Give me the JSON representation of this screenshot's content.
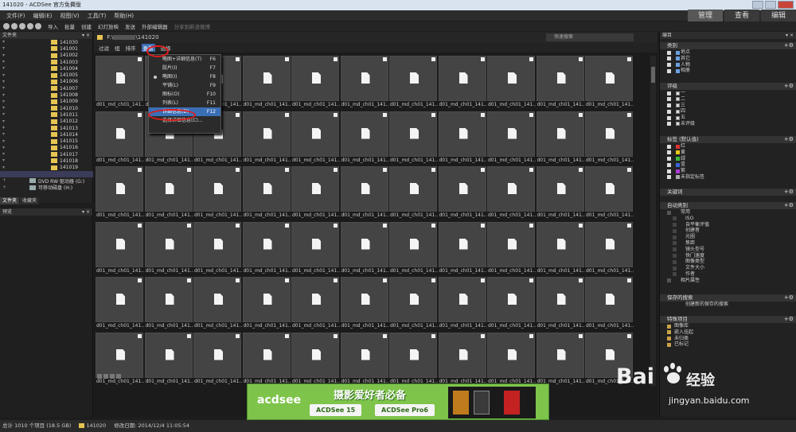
{
  "window": {
    "title": "141020 - ACDSee 官方免費版"
  },
  "menubar": {
    "items": [
      "文件(F)",
      "编辑(E)",
      "视图(V)",
      "工具(T)",
      "帮助(H)"
    ]
  },
  "modes": [
    "管理",
    "查看",
    "编辑"
  ],
  "toolbar": {
    "items": [
      "导入",
      "批量",
      "创建",
      "幻灯放映",
      "发送",
      "外部编辑器"
    ],
    "share": "分享到新浪微博"
  },
  "left_panel": {
    "title": "文件夹",
    "folders": [
      "141030",
      "141001",
      "141002",
      "141003",
      "141004",
      "141005",
      "141006",
      "141007",
      "141008",
      "141009",
      "141010",
      "141011",
      "141012",
      "141013",
      "141014",
      "141015",
      "141016",
      "141017",
      "141018",
      "141019"
    ],
    "drives": [
      "DVD RW 驱动器 (G:)",
      "可移动磁盘 (H:)"
    ],
    "tabs": [
      "文件夹",
      "收藏夹"
    ],
    "preview_title": "预览"
  },
  "center": {
    "path": "F:\\",
    "path_tail": "\\141020",
    "quick_search": "快速搜索",
    "filter_items": [
      "过滤",
      "组",
      "排序",
      "查看",
      "选择"
    ],
    "thumb_caption": "d01_md_ch01_141..."
  },
  "view_menu": {
    "items": [
      {
        "label": "略图+详细信息(T)",
        "key": "F6"
      },
      {
        "label": "胶片(I)",
        "key": "F7"
      },
      {
        "label": "略图(I)",
        "key": "F8"
      },
      {
        "label": "平铺(L)",
        "key": "F9"
      },
      {
        "label": "图标(O)",
        "key": "F10"
      },
      {
        "label": "列表(L)",
        "key": "F11"
      },
      {
        "label": "详细信息(D)",
        "key": "F12"
      },
      {
        "label": "选择详细信息(C)...",
        "key": ""
      }
    ]
  },
  "right_panel": {
    "title": "编目",
    "category": {
      "title": "类别",
      "items": [
        "地点",
        "其它",
        "人物",
        "相册"
      ]
    },
    "rating": {
      "title": "评级",
      "items": [
        "一",
        "二",
        "三",
        "四",
        "五",
        "未评级"
      ]
    },
    "labels": {
      "title": "标签 (默认值)",
      "items": [
        {
          "name": "红",
          "color": "#d33"
        },
        {
          "name": "黄",
          "color": "#e6c619"
        },
        {
          "name": "绿",
          "color": "#3ab83a"
        },
        {
          "name": "蓝",
          "color": "#3a64d8"
        },
        {
          "name": "紫",
          "color": "#a93ad8"
        },
        {
          "name": "未指定标签",
          "color": "#aaa"
        }
      ]
    },
    "keywords": {
      "title": "关键词"
    },
    "auto": {
      "title": "自动类别",
      "group": "常用",
      "items": [
        "ISO",
        "自平衡评值",
        "创建者",
        "光圈",
        "焦距",
        "镜头型号",
        "快门速度",
        "图像类型",
        "文件大小",
        "作者"
      ],
      "extra": "相片属性"
    },
    "saved": {
      "title": "保存的搜索",
      "item": "创建新的保存的搜索"
    },
    "special": {
      "title": "特殊项目",
      "items": [
        "图像库",
        "嵌入挂起",
        "未归类",
        "已标记"
      ]
    }
  },
  "banner": {
    "brand": "acdsee",
    "slogan": "摄影爱好者必备",
    "b1": "ACDSee 15",
    "b2": "ACDSee Pro6"
  },
  "status": {
    "count": "总计 1010 个项目 (18.5 GB)",
    "folder": "141020",
    "modified": "修改日期: 2014/12/4 11:05:54"
  },
  "watermark": {
    "bai": "Bai",
    "du": "du",
    "jy": "经验",
    "url": "jingyan.baidu.com"
  }
}
